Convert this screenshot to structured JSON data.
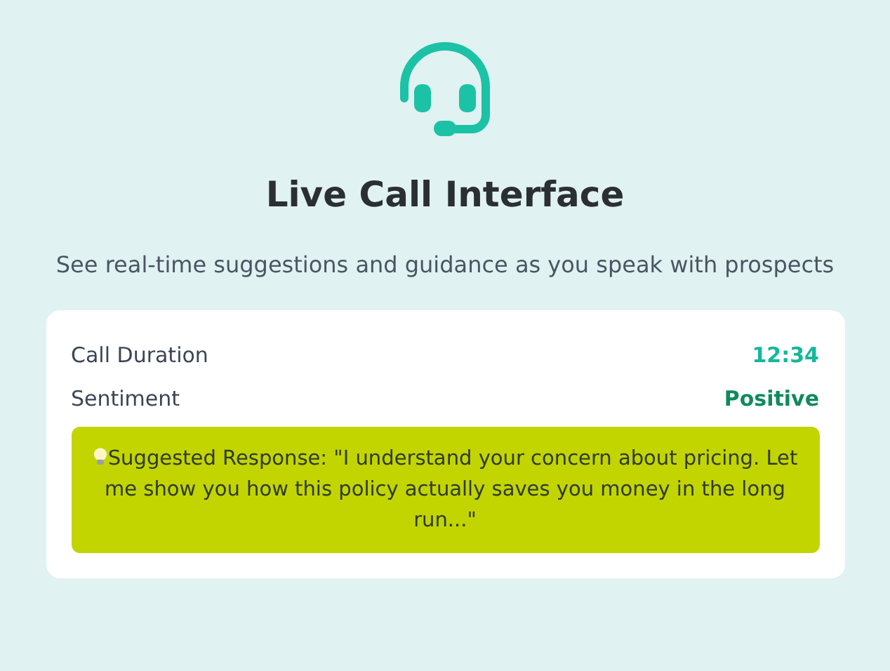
{
  "title": "Live Call Interface",
  "subtitle": "See real-time suggestions and guidance as you speak with prospects",
  "stats": [
    {
      "label": "Call Duration",
      "value": "12:34",
      "color": "#14b89a"
    },
    {
      "label": "Sentiment",
      "value": "Positive",
      "color": "#0f8a5f"
    }
  ],
  "suggestion": "Suggested Response: \"I understand your concern about pricing. Let me show you how this policy actually saves you money in the long run...\""
}
